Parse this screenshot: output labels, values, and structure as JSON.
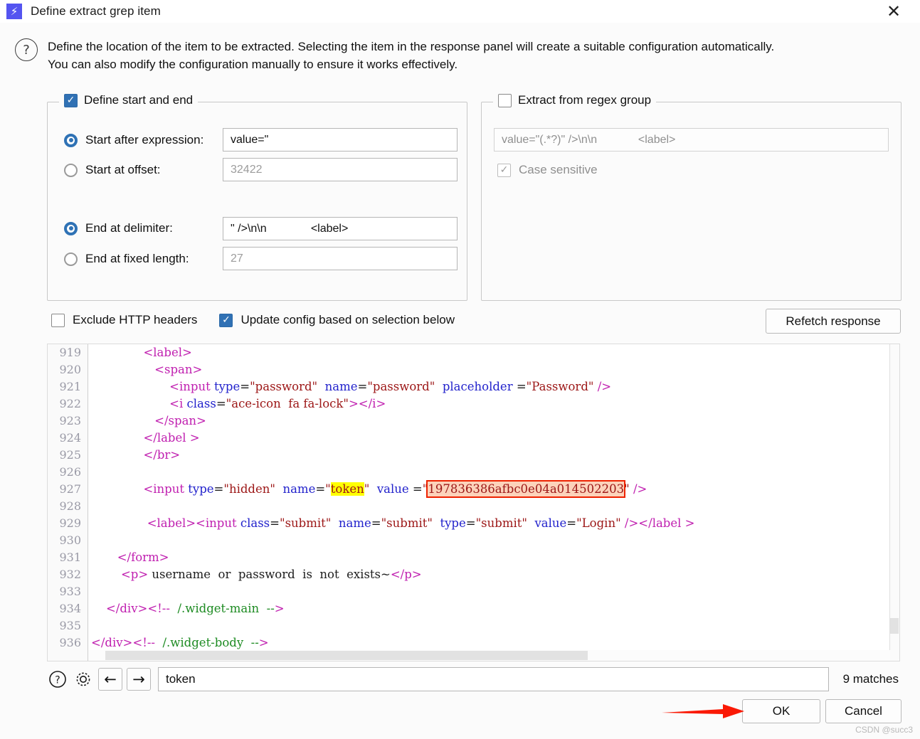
{
  "window": {
    "title": "Define extract grep item",
    "app_icon": "lightning-bolt-icon",
    "close_label": "✕"
  },
  "description": {
    "icon": "question-mark-icon",
    "line1": "Define the location of the item to be extracted. Selecting the item in the response panel will create a suitable configuration automatically.",
    "line2": "You can also modify the configuration manually to ensure it works effectively."
  },
  "start_end_group": {
    "title": "Define start and end",
    "checked": true,
    "start_after_expression": {
      "label": "Start after expression:",
      "selected": true,
      "value": "value=\""
    },
    "start_at_offset": {
      "label": "Start at offset:",
      "selected": false,
      "placeholder": "32422"
    },
    "end_at_delimiter": {
      "label": "End at delimiter:",
      "selected": true,
      "value": "\" />\\n\\n              <label>"
    },
    "end_at_fixed_length": {
      "label": "End at fixed length:",
      "selected": false,
      "placeholder": "27"
    }
  },
  "regex_group": {
    "title": "Extract from regex group",
    "checked": false,
    "pattern_placeholder": "value=\"(.*?)\" />\\n\\n             <label>",
    "case_sensitive_label": "Case sensitive",
    "case_sensitive_checked": true
  },
  "options": {
    "exclude_http_headers": {
      "label": "Exclude HTTP headers",
      "checked": false
    },
    "update_config": {
      "label": "Update config based on selection below",
      "checked": true
    },
    "refetch_label": "Refetch response"
  },
  "editor": {
    "lines": [
      {
        "n": "919",
        "segs": [
          {
            "t": "txt",
            "s": "              "
          },
          {
            "t": "tag",
            "s": "<label>"
          }
        ]
      },
      {
        "n": "920",
        "segs": [
          {
            "t": "txt",
            "s": "                 "
          },
          {
            "t": "tag",
            "s": "<span>"
          }
        ]
      },
      {
        "n": "921",
        "segs": [
          {
            "t": "txt",
            "s": "                     "
          },
          {
            "t": "tag",
            "s": "<input"
          },
          {
            "t": "txt",
            "s": " "
          },
          {
            "t": "attr",
            "s": "type"
          },
          {
            "t": "txt",
            "s": "="
          },
          {
            "t": "val",
            "s": "\"password\""
          },
          {
            "t": "txt",
            "s": "  "
          },
          {
            "t": "attr",
            "s": "name"
          },
          {
            "t": "txt",
            "s": "="
          },
          {
            "t": "val",
            "s": "\"password\""
          },
          {
            "t": "txt",
            "s": "  "
          },
          {
            "t": "attr",
            "s": "placeholder"
          },
          {
            "t": "txt",
            "s": " ="
          },
          {
            "t": "val",
            "s": "\"Password\""
          },
          {
            "t": "txt",
            "s": " "
          },
          {
            "t": "tag",
            "s": "/>"
          }
        ]
      },
      {
        "n": "922",
        "segs": [
          {
            "t": "txt",
            "s": "                     "
          },
          {
            "t": "tag",
            "s": "<i"
          },
          {
            "t": "txt",
            "s": " "
          },
          {
            "t": "attr",
            "s": "class"
          },
          {
            "t": "txt",
            "s": "="
          },
          {
            "t": "val",
            "s": "\"ace-icon  fa fa-lock\""
          },
          {
            "t": "tag",
            "s": "></i>"
          }
        ]
      },
      {
        "n": "923",
        "segs": [
          {
            "t": "txt",
            "s": "                 "
          },
          {
            "t": "tag",
            "s": "</span>"
          }
        ]
      },
      {
        "n": "924",
        "segs": [
          {
            "t": "txt",
            "s": "              "
          },
          {
            "t": "tag",
            "s": "</label >"
          }
        ]
      },
      {
        "n": "925",
        "segs": [
          {
            "t": "txt",
            "s": "              "
          },
          {
            "t": "tag",
            "s": "</br>"
          }
        ]
      },
      {
        "n": "926",
        "segs": []
      },
      {
        "n": "927",
        "segs": [
          {
            "t": "txt",
            "s": "              "
          },
          {
            "t": "tag",
            "s": "<input"
          },
          {
            "t": "txt",
            "s": " "
          },
          {
            "t": "attr",
            "s": "type"
          },
          {
            "t": "txt",
            "s": "="
          },
          {
            "t": "val",
            "s": "\"hidden\""
          },
          {
            "t": "txt",
            "s": "  "
          },
          {
            "t": "attr",
            "s": "name"
          },
          {
            "t": "txt",
            "s": "="
          },
          {
            "t": "val",
            "s": "\""
          },
          {
            "t": "mark",
            "s": "token"
          },
          {
            "t": "val",
            "s": "\""
          },
          {
            "t": "txt",
            "s": "  "
          },
          {
            "t": "attr",
            "s": "value"
          },
          {
            "t": "txt",
            "s": " ="
          },
          {
            "t": "val",
            "s": "\""
          },
          {
            "t": "selv",
            "s": "197836386afbc0e04a014502203"
          },
          {
            "t": "val",
            "s": "\""
          },
          {
            "t": "txt",
            "s": " "
          },
          {
            "t": "tag",
            "s": "/>"
          }
        ]
      },
      {
        "n": "928",
        "segs": []
      },
      {
        "n": "929",
        "segs": [
          {
            "t": "txt",
            "s": "               "
          },
          {
            "t": "tag",
            "s": "<label><input"
          },
          {
            "t": "txt",
            "s": " "
          },
          {
            "t": "attr",
            "s": "class"
          },
          {
            "t": "txt",
            "s": "="
          },
          {
            "t": "val",
            "s": "\"submit\""
          },
          {
            "t": "txt",
            "s": "  "
          },
          {
            "t": "attr",
            "s": "name"
          },
          {
            "t": "txt",
            "s": "="
          },
          {
            "t": "val",
            "s": "\"submit\""
          },
          {
            "t": "txt",
            "s": "  "
          },
          {
            "t": "attr",
            "s": "type"
          },
          {
            "t": "txt",
            "s": "="
          },
          {
            "t": "val",
            "s": "\"submit\""
          },
          {
            "t": "txt",
            "s": "  "
          },
          {
            "t": "attr",
            "s": "value"
          },
          {
            "t": "txt",
            "s": "="
          },
          {
            "t": "val",
            "s": "\"Login\""
          },
          {
            "t": "txt",
            "s": " "
          },
          {
            "t": "tag",
            "s": "/></label >"
          }
        ]
      },
      {
        "n": "930",
        "segs": []
      },
      {
        "n": "931",
        "segs": [
          {
            "t": "txt",
            "s": "       "
          },
          {
            "t": "tag",
            "s": "</form>"
          }
        ]
      },
      {
        "n": "932",
        "segs": [
          {
            "t": "txt",
            "s": "        "
          },
          {
            "t": "tag",
            "s": "<p>"
          },
          {
            "t": "txt",
            "s": " username  or  password  is  not  exists~"
          },
          {
            "t": "tag",
            "s": "</p>"
          }
        ]
      },
      {
        "n": "933",
        "segs": []
      },
      {
        "n": "934",
        "segs": [
          {
            "t": "txt",
            "s": "    "
          },
          {
            "t": "tag",
            "s": "</div><!--"
          },
          {
            "t": "cmt",
            "s": "  /.widget-main  --"
          },
          {
            "t": "tag",
            "s": ">"
          }
        ]
      },
      {
        "n": "935",
        "segs": []
      },
      {
        "n": "936",
        "segs": [
          {
            "t": "tag",
            "s": "</div><!--"
          },
          {
            "t": "cmt",
            "s": "  /.widget-body  --"
          },
          {
            "t": "tag",
            "s": ">"
          }
        ]
      }
    ]
  },
  "findbar": {
    "help_icon": "question-mark-icon",
    "settings_icon": "gear-icon",
    "prev_icon": "arrow-left-icon",
    "next_icon": "arrow-right-icon",
    "prev_label": "←",
    "next_label": "→",
    "search_value": "token",
    "matches": "9 matches"
  },
  "footer": {
    "ok_label": "OK",
    "cancel_label": "Cancel",
    "watermark": "CSDN @succ3"
  },
  "colors": {
    "accent": "#3071b4",
    "radio": "#2f72b5",
    "highlight_yellow": "#ffff00",
    "selection_peach": "#fcd3bb",
    "selection_border": "#ee2200",
    "annotation_red": "#fa1905"
  }
}
